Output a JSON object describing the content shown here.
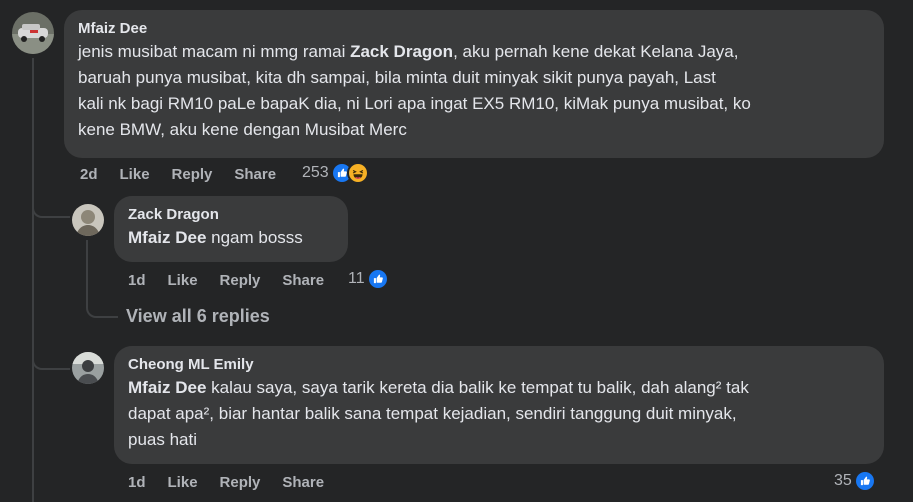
{
  "comments": [
    {
      "author": "Mfaiz Dee",
      "text_line1_pre": "jenis musibat macam ni mmg ramai ",
      "text_line1_mention": "Zack Dragon",
      "text_line1_post": ", aku pernah kene dekat Kelana Jaya,",
      "text_line2": "baruah punya musibat, kita dh sampai, bila minta duit minyak sikit punya payah, Last",
      "text_line3": "kali nk bagi RM10 paLe bapaK dia, ni Lori apa ingat EX5 RM10, kiMak punya musibat, ko",
      "text_line4": "kene BMW, aku kene dengan Musibat Merc",
      "time": "2d",
      "like": "Like",
      "reply": "Reply",
      "share": "Share",
      "reaction_count": "253",
      "reactions": [
        "like-icon",
        "haha-icon"
      ]
    },
    {
      "author": "Zack Dragon",
      "mention": "Mfaiz Dee",
      "text": " ngam bosss",
      "time": "1d",
      "like": "Like",
      "reply": "Reply",
      "share": "Share",
      "reaction_count": "11",
      "reactions": [
        "like-icon"
      ]
    },
    {
      "author": "Cheong ML Emily",
      "mention": "Mfaiz Dee",
      "text_line1": " kalau saya, saya tarik kereta dia balik ke tempat tu balik, dah alang² tak",
      "text_line2": "dapat apa², biar hantar balik sana tempat kejadian, sendiri tanggung duit minyak,",
      "text_line3": "puas hati",
      "time": "1d",
      "like": "Like",
      "reply": "Reply",
      "share": "Share",
      "reaction_count": "35",
      "reactions": [
        "like-icon"
      ]
    }
  ],
  "view_replies": "View all 6 replies",
  "colors": {
    "background": "#242526",
    "bubble": "#3a3b3c",
    "text": "#e4e6eb",
    "secondary": "#b0b3b8",
    "like_blue": "#1877f2",
    "haha_yellow": "#f7b125"
  }
}
